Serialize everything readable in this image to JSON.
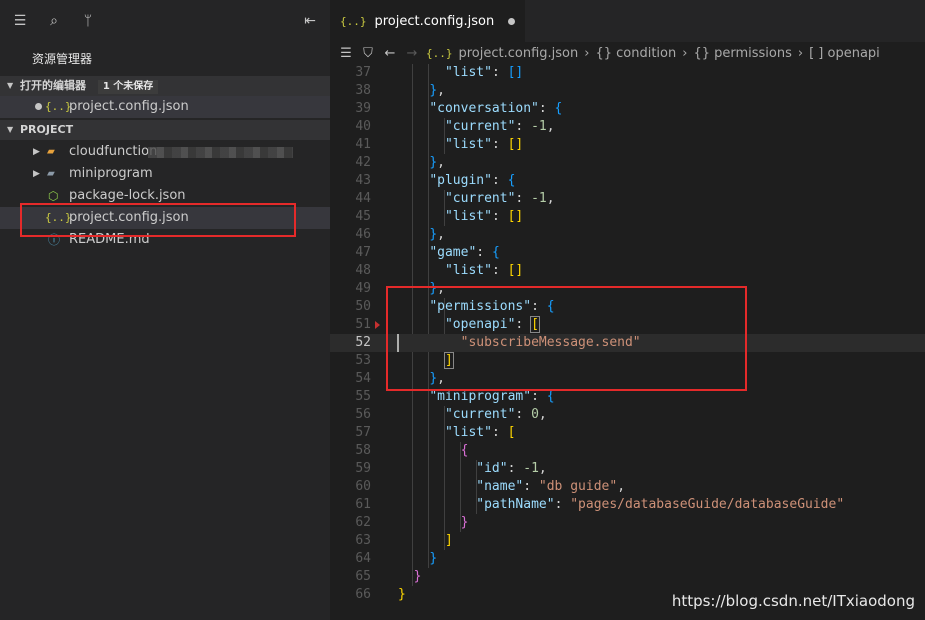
{
  "sidebar": {
    "explorer_title": "资源管理器",
    "open_editors": {
      "label": "打开的编辑器",
      "badge": "1 个未保存",
      "file": "project.config.json"
    },
    "project": {
      "label": "PROJECT"
    },
    "items": [
      {
        "name": "cloudfunctions",
        "icon": "folder-icon"
      },
      {
        "name": "miniprogram",
        "icon": "folder-icon"
      },
      {
        "name": "package-lock.json",
        "icon": "nodejs-icon"
      },
      {
        "name": "project.config.json",
        "icon": "json-icon"
      },
      {
        "name": "README.md",
        "icon": "info-icon"
      }
    ],
    "cloudfunctions_label": "cloudfunction"
  },
  "editor": {
    "tab": {
      "label": "project.config.json",
      "icon": "{..}"
    },
    "breadcrumb": {
      "file": "project.config.json",
      "sep": "›",
      "p1": "{} condition",
      "p2": "{} permissions",
      "p3": "[ ] openapi"
    },
    "gutter": [
      "37",
      "38",
      "39",
      "40",
      "41",
      "42",
      "43",
      "44",
      "45",
      "46",
      "47",
      "48",
      "49",
      "50",
      "51",
      "52",
      "53",
      "54",
      "55",
      "56",
      "57",
      "58",
      "59",
      "60",
      "61",
      "62",
      "63",
      "64",
      "65",
      "66"
    ]
  },
  "code": {
    "list_key": "\"list\"",
    "current_key": "\"current\"",
    "conversation_key": "\"conversation\"",
    "plugin_key": "\"plugin\"",
    "game_key": "\"game\"",
    "permissions_key": "\"permissions\"",
    "openapi_key": "\"openapi\"",
    "subscribe_value": "\"subscribeMessage.send\"",
    "miniprogram_key": "\"miniprogram\"",
    "id_key": "\"id\"",
    "name_key": "\"name\"",
    "pathName_key": "\"pathName\"",
    "name_value": "\"db guide\"",
    "pathName_value": "\"pages/databaseGuide/databaseGuide\"",
    "neg_one": "-1",
    "zero": "0"
  },
  "watermark": "https://blog.csdn.net/ITxiaodong",
  "colors": {
    "highlight_box": "#e52a2a",
    "json_icon": "#cbcb41"
  }
}
